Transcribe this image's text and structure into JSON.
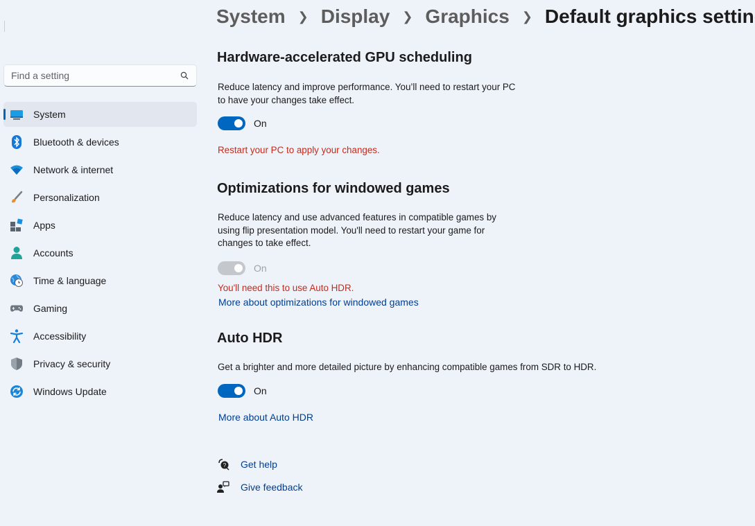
{
  "breadcrumb": [
    "System",
    "Display",
    "Graphics",
    "Default graphics settings"
  ],
  "search": {
    "placeholder": "Find a setting"
  },
  "sidebar": {
    "items": [
      {
        "label": "System",
        "icon": "system-icon",
        "active": true
      },
      {
        "label": "Bluetooth & devices",
        "icon": "bluetooth-icon"
      },
      {
        "label": "Network & internet",
        "icon": "wifi-icon"
      },
      {
        "label": "Personalization",
        "icon": "brush-icon"
      },
      {
        "label": "Apps",
        "icon": "apps-icon"
      },
      {
        "label": "Accounts",
        "icon": "person-icon"
      },
      {
        "label": "Time & language",
        "icon": "globe-clock-icon"
      },
      {
        "label": "Gaming",
        "icon": "gamepad-icon"
      },
      {
        "label": "Accessibility",
        "icon": "accessibility-icon"
      },
      {
        "label": "Privacy & security",
        "icon": "shield-icon"
      },
      {
        "label": "Windows Update",
        "icon": "update-icon"
      }
    ]
  },
  "gpu_scheduling": {
    "title": "Hardware-accelerated GPU scheduling",
    "desc_line1": "Reduce latency and improve performance. You’ll need to restart your PC",
    "desc_line2": "to have your changes take effect.",
    "toggle_state": "On",
    "toggle_on": true,
    "warning": "Restart your PC to apply your changes."
  },
  "windowed_games": {
    "title": "Optimizations for windowed games",
    "desc_line1": "Reduce latency and use advanced features in compatible games by",
    "desc_line2": "using flip presentation model. You'll need to restart your game for",
    "desc_line3": "changes to take effect.",
    "toggle_state": "On",
    "toggle_on": true,
    "toggle_disabled": true,
    "warning": "You'll need this to use Auto HDR.",
    "link": "More about optimizations for windowed games"
  },
  "auto_hdr": {
    "title": "Auto HDR",
    "desc": "Get a brighter and more detailed picture by enhancing compatible games from SDR to HDR.",
    "toggle_state": "On",
    "toggle_on": true,
    "link": "More about Auto HDR"
  },
  "footer": {
    "get_help": "Get help",
    "give_feedback": "Give feedback"
  },
  "colors": {
    "accent": "#0067c0",
    "warning": "#c42b1c",
    "link": "#003e92",
    "background": "#eef2f9"
  }
}
